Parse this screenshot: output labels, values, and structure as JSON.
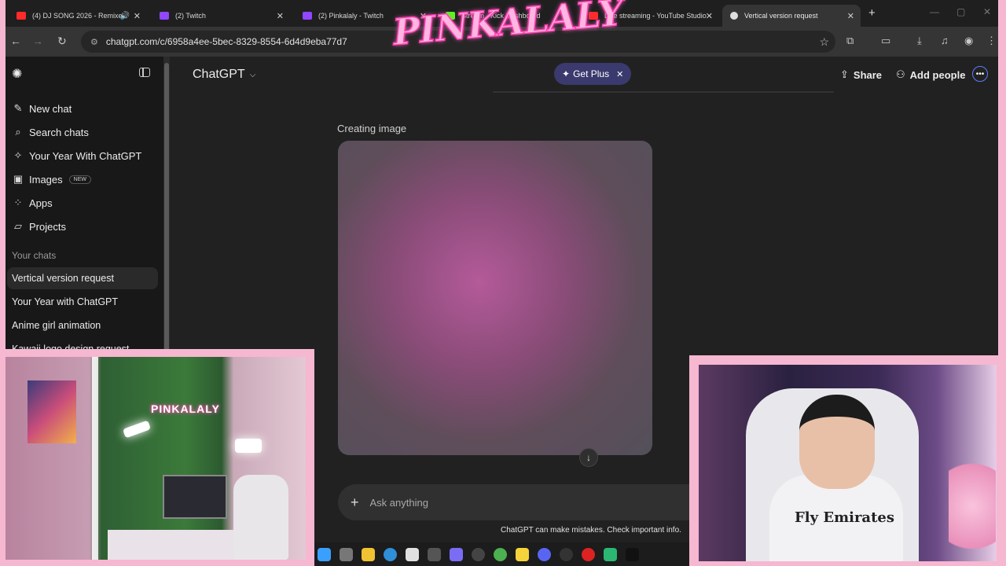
{
  "tabs": [
    {
      "title": "(4) DJ SONG 2026 - Remixes",
      "favicon_color": "#ff2a2a",
      "audio": true
    },
    {
      "title": "(2) Twitch",
      "favicon_color": "#9146ff"
    },
    {
      "title": "(2) Pinkalaly - Twitch",
      "favicon_color": "#9146ff"
    },
    {
      "title": "Stream - Kick Dashboard",
      "favicon_color": "#53fc18"
    },
    {
      "title": "Live streaming - YouTube Studio",
      "favicon_color": "#ff2a2a"
    },
    {
      "title": "Vertical version request",
      "favicon_color": "#dddddd",
      "active": true
    }
  ],
  "address_bar": {
    "url": "chatgpt.com/c/6958a4ee-5bec-8329-8554-6d4d9eba77d7"
  },
  "overlay_logo": "PINKALALY",
  "sidebar": {
    "nav": [
      {
        "label": "New chat",
        "icon": "edit-icon"
      },
      {
        "label": "Search chats",
        "icon": "search-icon"
      },
      {
        "label": "Your Year With ChatGPT",
        "icon": "sparkle-icon"
      },
      {
        "label": "Images",
        "icon": "images-icon",
        "badge": "NEW"
      },
      {
        "label": "Apps",
        "icon": "apps-icon"
      },
      {
        "label": "Projects",
        "icon": "folder-icon"
      }
    ],
    "chats_heading": "Your chats",
    "chats": [
      {
        "label": "Vertical version request",
        "active": true
      },
      {
        "label": "Your Year with ChatGPT"
      },
      {
        "label": "Anime girl animation"
      },
      {
        "label": "Kawaii logo design request"
      }
    ]
  },
  "header": {
    "title": "ChatGPT",
    "get_plus": "Get Plus",
    "share": "Share",
    "add_people": "Add people"
  },
  "main": {
    "status": "Creating image",
    "composer_placeholder": "Ask anything",
    "disclaimer": "ChatGPT can make mistakes. Check important info."
  },
  "webcam_room": {
    "sign": "PINKALALY"
  },
  "webcam_face": {
    "shirt_text": "Fly Emirates"
  },
  "colors": {
    "accent": "#5b7cff",
    "frame": "#f6b7d0",
    "get_plus_bg": "#3a3a6e"
  }
}
